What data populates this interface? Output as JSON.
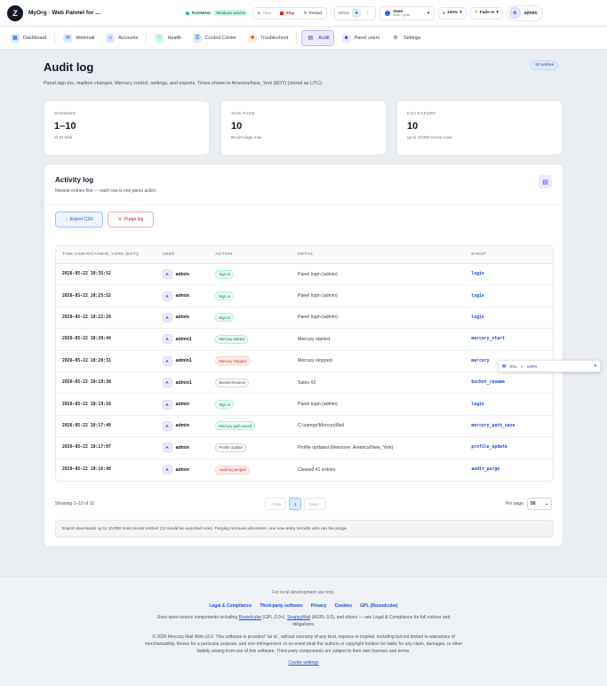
{
  "app": {
    "title": "MyOrg · Web Pannel for ...",
    "logo_letter": "Z"
  },
  "status": {
    "running": "RUNNING",
    "service": "Windows service"
  },
  "controls": {
    "start": "Start",
    "stop": "Stop",
    "restart": "Restart"
  },
  "mode": {
    "label": "MODE"
  },
  "theme": {
    "name": "Slate",
    "sub": "Blue / cyan"
  },
  "zoom": "100%",
  "fade": "Fade In",
  "user": {
    "initial": "A",
    "name": "admin"
  },
  "nav": [
    {
      "label": "Dashboard",
      "icon": "dashboard-icon"
    },
    {
      "label": "Webmail",
      "icon": "mail-icon"
    },
    {
      "label": "Accounts",
      "icon": "users-icon"
    },
    {
      "label": "Health",
      "icon": "heart-icon"
    },
    {
      "label": "Control Center",
      "icon": "sliders-icon"
    },
    {
      "label": "Troubleshoot",
      "icon": "tool-icon"
    },
    {
      "label": "Audit",
      "icon": "clipboard-icon"
    },
    {
      "label": "Panel users",
      "icon": "user-shield-icon"
    },
    {
      "label": "Settings",
      "icon": "gear-icon"
    }
  ],
  "page": {
    "title": "Audit log",
    "subtitle": "Panel sign-ins, mailbox changes, Mercury control, settings, and exports. Times shown in America/New_York (EDT) (stored as UTC).",
    "badge": "10 entries"
  },
  "stats": [
    {
      "label": "SHOWING",
      "value": "1–10",
      "sub": "of 10 total"
    },
    {
      "label": "THIS PAGE",
      "value": "10",
      "sub": "50 per page max"
    },
    {
      "label": "CSV EXPORT",
      "value": "10",
      "sub": "up to 10,000 recent rows"
    }
  ],
  "log": {
    "title": "Activity log",
    "subtitle": "Newest entries first — each row is one panel action",
    "export_btn": "Export CSV",
    "purge_btn": "Purge log",
    "headers": [
      "TIME (AMERICA/NEW_YORK (EDT))",
      "USER",
      "ACTION",
      "DETAIL",
      "EVENT"
    ],
    "rows": [
      {
        "time": "2026-05-22 10:35:52",
        "user": "admin",
        "action": "Sign in",
        "tone": "green",
        "detail": "Panel login (admin)",
        "event": "login"
      },
      {
        "time": "2026-05-22 10:25:52",
        "user": "admin",
        "action": "Sign in",
        "tone": "green",
        "detail": "Panel login (admin)",
        "event": "login"
      },
      {
        "time": "2026-05-22 10:22:26",
        "user": "admin",
        "action": "Sign in",
        "tone": "green",
        "detail": "Panel login (admin)",
        "event": "login"
      },
      {
        "time": "2026-05-22 10:20:44",
        "user": "admin1",
        "action": "Mercury started",
        "tone": "green",
        "detail": "Mercury started.",
        "event": "mercury_start"
      },
      {
        "time": "2026-05-22 10:20:31",
        "user": "admin1",
        "action": "Mercury stopped",
        "tone": "red",
        "detail": "Mercury stopped.",
        "event": "mercury"
      },
      {
        "time": "2026-05-22 10:19:38",
        "user": "admin1",
        "action": "Bucket Rename",
        "tone": "gray",
        "detail": "Sales #2",
        "event": "bucket_rename"
      },
      {
        "time": "2026-05-22 10:19:10",
        "user": "admin",
        "action": "Sign in",
        "tone": "green",
        "detail": "Panel login (admin)",
        "event": "login"
      },
      {
        "time": "2026-05-22 10:17:40",
        "user": "admin",
        "action": "Mercury path saved",
        "tone": "green",
        "detail": "C:\\xampp\\MercuryMail",
        "event": "mercury_path_save"
      },
      {
        "time": "2026-05-22 10:17:07",
        "user": "admin",
        "action": "Profile Update",
        "tone": "gray",
        "detail": "Profile updated (timezone: America/New_York)",
        "event": "profile_update"
      },
      {
        "time": "2026-05-22 10:16:40",
        "user": "admin",
        "action": "Audit log purged",
        "tone": "red",
        "detail": "Cleared 41 entries",
        "event": "audit_purge"
      }
    ],
    "showing": "Showing 1–10 of 10",
    "prev": "‹ Prev",
    "page_num": "1",
    "next": "Next ›",
    "per_page_label": "Per page",
    "per_page_value": "50",
    "note": "Export downloads up to 10,000 most recent entries (10 would be exported now). Purging removes all entries; one new entry records who ran the purge."
  },
  "popup": {
    "size": "XXL",
    "zoom": "100%"
  },
  "footer": {
    "local": "For local development use only.",
    "links": [
      "Legal & Compliance",
      "Third-party software",
      "Privacy",
      "Cookies",
      "GPL (Roundcube)"
    ],
    "os_pre": "Uses open-source components including ",
    "os_link1": "Roundcube",
    "os_mid": " (GPL-3.0+), ",
    "os_link2": "SnappyMail",
    "os_post": " (AGPL-3.0), and others — see Legal & Compliance for full notices and obligations.",
    "copyright": "© 2026 Mercury Mail Web v3.0. This software is provided \"as is\", without warranty of any kind, express or implied, including but not limited to warranties of merchantability, fitness for a particular purpose, and non-infringement. In no event shall the authors or copyright holders be liable for any claim, damages, or other liability arising from use of this software. Third-party components are subject to their own licenses and terms.",
    "cookie": "Cookie settings"
  }
}
